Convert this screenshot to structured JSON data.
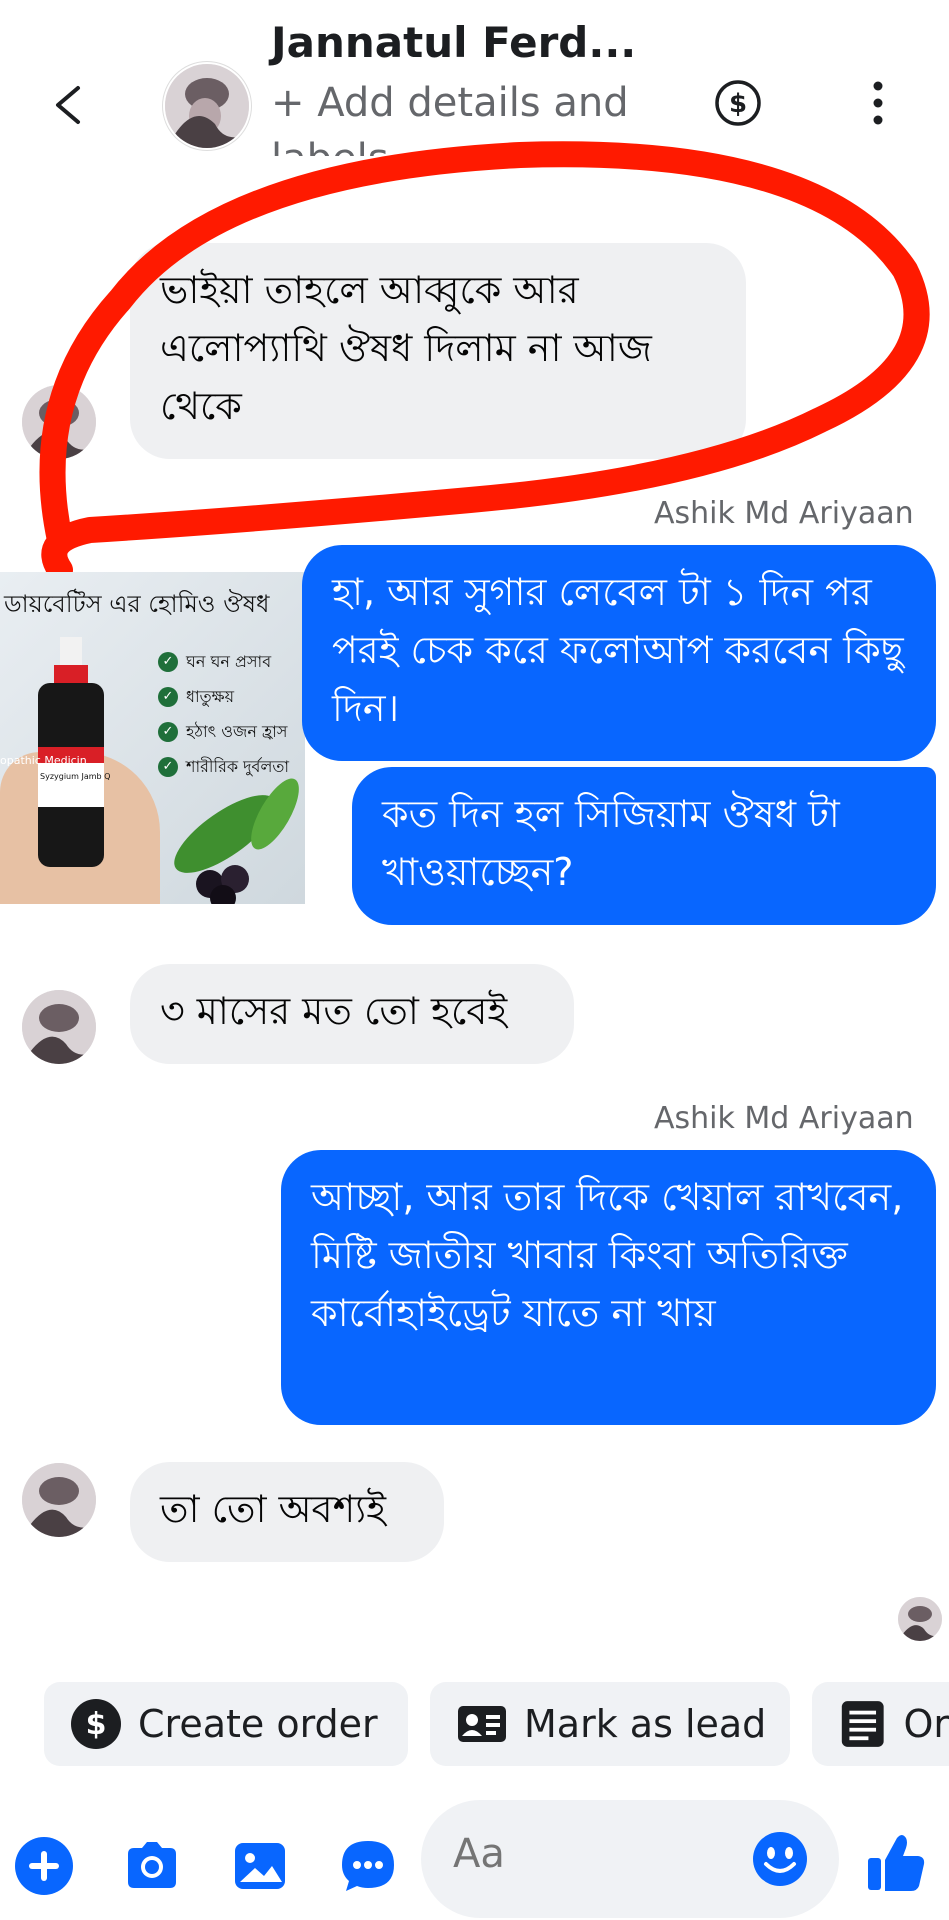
{
  "header": {
    "back_icon": "chevron-left-icon",
    "title": "Jannatul Ferd...",
    "subtitle": "+ Add details and",
    "subtitle_cut": "labels",
    "actions": [
      "dollar-icon",
      "more-vertical-icon"
    ]
  },
  "messages": [
    {
      "from": "contact",
      "text": "ভাইয়া তাহলে আব্বুকে আর এলোপ্যাথি ঔষধ দিলাম না আজ থেকে"
    },
    {
      "from": "me",
      "sender": "Ashik Md Ariyaan",
      "text": "হা, আর সুগার লেবেল টা ১ দিন পর পরই চেক করে ফলোআপ করবেন কিছু দিন।"
    },
    {
      "from": "me",
      "text": "কত দিন হল সিজিয়াম ঔষধ টা খাওয়াচ্ছেন?"
    },
    {
      "from": "contact",
      "text": "৩ মাসের মত তো হবেই"
    },
    {
      "from": "me",
      "sender": "Ashik Md Ariyaan",
      "text": "আচ্ছা, আর তার দিকে খেয়াল রাখবেন, মিষ্টি জাতীয় খাবার কিংবা অতিরিক্ত কার্বোহাইড্রেট যাতে না খায়"
    },
    {
      "from": "contact",
      "text": "তা তো অবশ্যই"
    }
  ],
  "image_card": {
    "title": "ডায়বেটিস এর হোমিও ঔষধ",
    "items": [
      "ঘন ঘন প্রসাব",
      "ধাতুক্ষয়",
      "হঠাৎ ওজন হ্রাস",
      "শারীরিক দুর্বলতা"
    ],
    "bottle_label": "opathic Medicin",
    "bottle_sub": "Syzygium Jamb Q"
  },
  "action_chips": [
    {
      "label": "Create order",
      "icon": "dollar-icon"
    },
    {
      "label": "Mark as lead",
      "icon": "contact-card-icon"
    },
    {
      "label": "Or",
      "icon": "list-icon"
    }
  ],
  "composer": {
    "placeholder": "Aa",
    "left_icons": [
      "plus-icon",
      "camera-icon",
      "gallery-icon",
      "chat-bubble-icon"
    ],
    "emoji_icon": "emoji-icon",
    "send_icon": "thumbs-up-icon"
  },
  "colors": {
    "outgoing": "#0866ff",
    "incoming": "#eff0f2",
    "annotation": "#ff1a00",
    "accent": "#0866ff"
  }
}
